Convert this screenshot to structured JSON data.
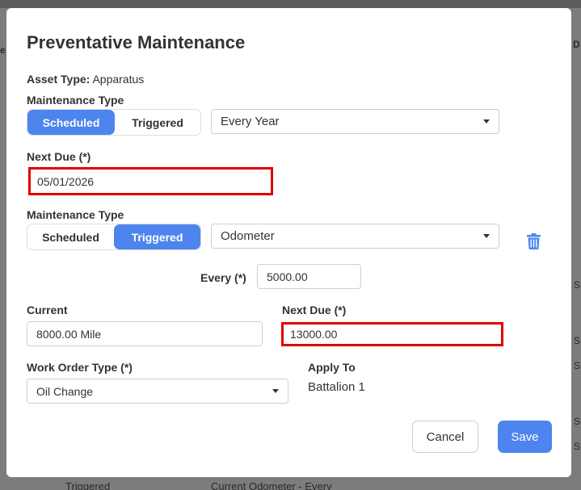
{
  "background": {
    "right_column_label": "D",
    "left_column_label": "e",
    "bottom_row": {
      "col1": "Triggered",
      "col2": "Current Odometer - Every"
    },
    "right_edge_marks": [
      "S",
      "S",
      "S",
      "S",
      "S"
    ]
  },
  "modal": {
    "title": "Preventative Maintenance",
    "asset_type": {
      "label": "Asset Type:",
      "value": "Apparatus"
    },
    "schedule1": {
      "label": "Maintenance Type",
      "options": [
        "Scheduled",
        "Triggered"
      ],
      "selected": "Scheduled",
      "frequency": "Every Year",
      "next_due_label": "Next Due (*)",
      "next_due_value": "05/01/2026"
    },
    "schedule2": {
      "label": "Maintenance Type",
      "options": [
        "Scheduled",
        "Triggered"
      ],
      "selected": "Triggered",
      "trigger": "Odometer",
      "every_label": "Every (*)",
      "every_value": "5000.00",
      "current_label": "Current",
      "current_value": "8000.00 Mile",
      "next_due_label": "Next Due (*)",
      "next_due_value": "13000.00"
    },
    "work_order": {
      "label": "Work Order Type (*)",
      "value": "Oil Change"
    },
    "apply_to": {
      "label": "Apply To",
      "value": "Battalion 1"
    },
    "buttons": {
      "cancel": "Cancel",
      "save": "Save"
    }
  },
  "colors": {
    "accent": "#4d84ee",
    "highlight": "#e00000",
    "trash": "#4d84ee"
  }
}
